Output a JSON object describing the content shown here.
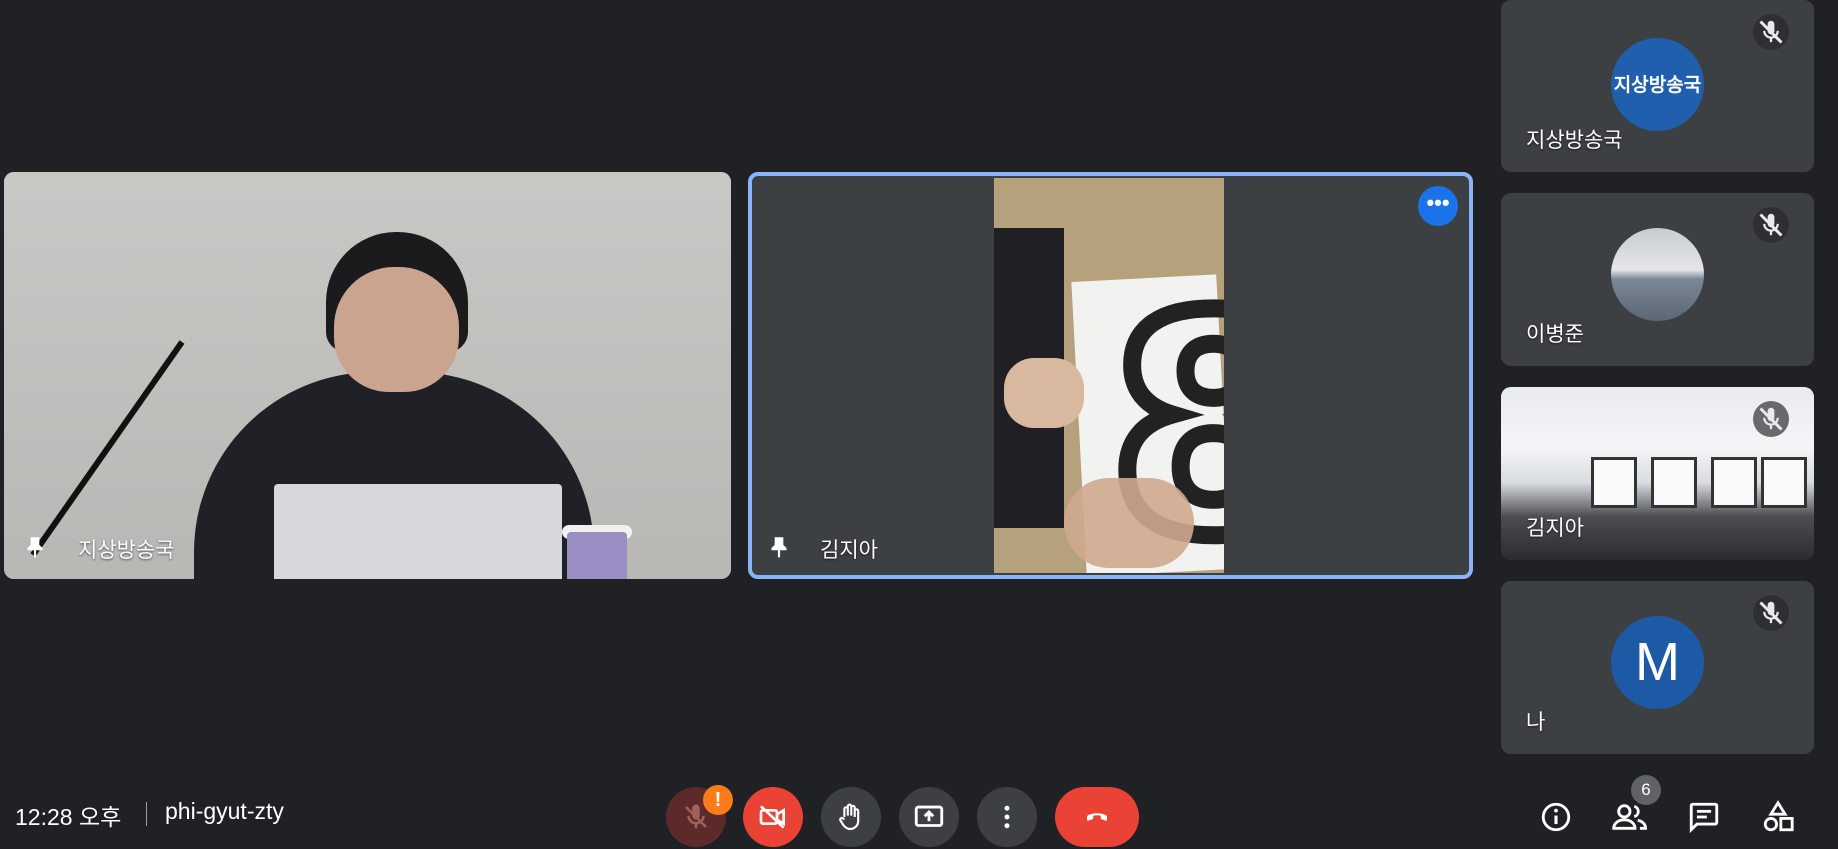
{
  "main_tiles": [
    {
      "name": "지상방송국"
    },
    {
      "name": "김지아"
    }
  ],
  "side_tiles": [
    {
      "name": "지상방송국",
      "avatar_text": "지상방송국"
    },
    {
      "name": "이병준"
    },
    {
      "name": "김지아"
    },
    {
      "name": "나",
      "avatar_letter": "M"
    }
  ],
  "footer": {
    "time": "12:28 오후",
    "meeting_code": "phi-gyut-zty",
    "mic_warning": "!",
    "participants_count": "6"
  },
  "colors": {
    "background": "#202124",
    "tile": "#3c4043",
    "active_outline": "#8ab4f8",
    "end_call": "#ea4335",
    "warning": "#fa7b17",
    "avatar_blue": "#1c5aa6"
  },
  "icons": [
    "pin-icon",
    "more-options-icon",
    "mic-off-icon",
    "camera-off-icon",
    "raise-hand-icon",
    "present-screen-icon",
    "more-vert-icon",
    "end-call-icon",
    "info-icon",
    "people-icon",
    "chat-icon",
    "activities-icon"
  ]
}
